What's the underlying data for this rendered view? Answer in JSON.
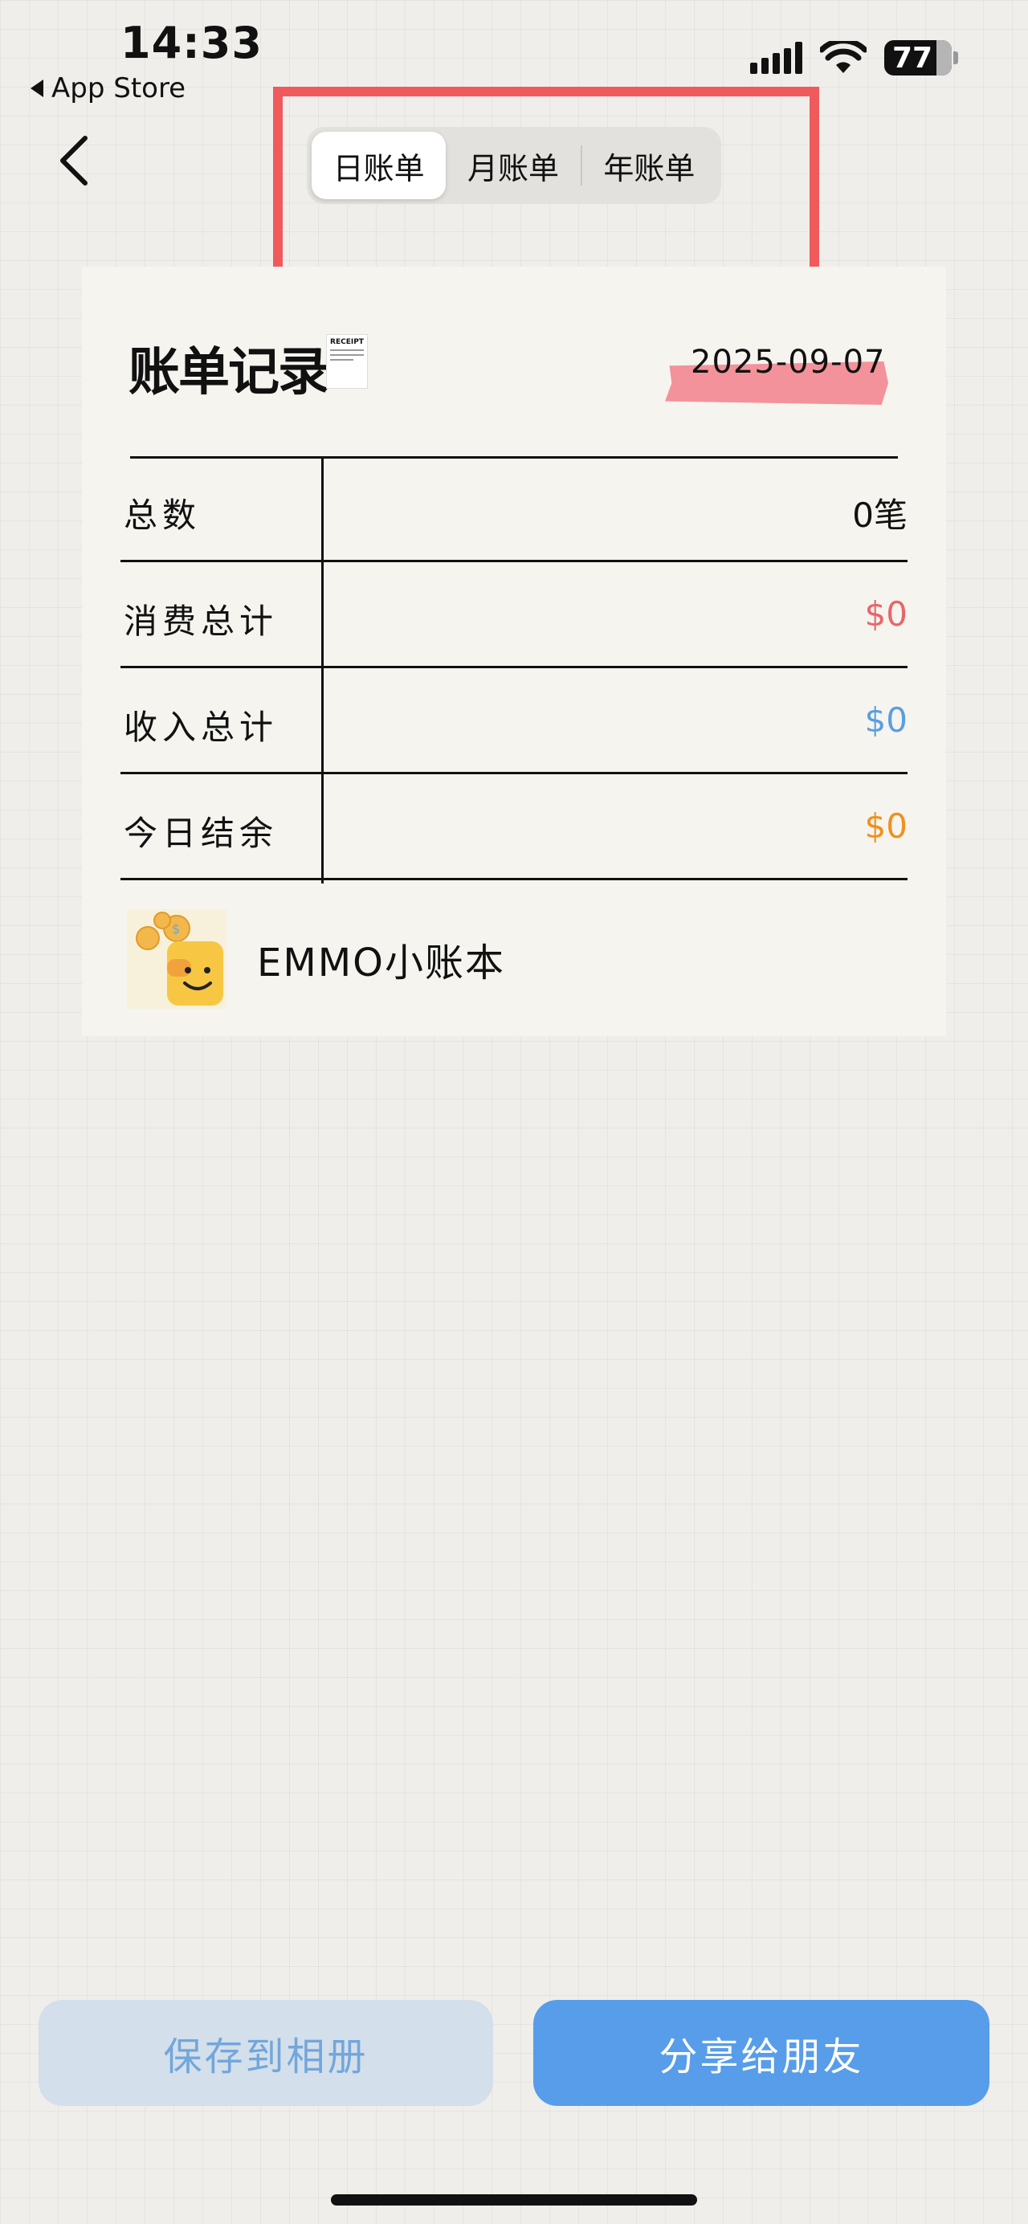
{
  "status_bar": {
    "time": "14:33",
    "back_app": "App Store",
    "battery": "77"
  },
  "tabs": [
    {
      "label": "日账单",
      "active": true
    },
    {
      "label": "月账单",
      "active": false
    },
    {
      "label": "年账单",
      "active": false
    }
  ],
  "card": {
    "title": "账单记录",
    "receipt_icon_text": "RECEIPT",
    "date": "2025-09-07",
    "rows": [
      {
        "label": "总数",
        "value": "0笔",
        "color": "#111111"
      },
      {
        "label": "消费总计",
        "value": "$0",
        "color": "#e8666a"
      },
      {
        "label": "收入总计",
        "value": "$0",
        "color": "#5a9ee0"
      },
      {
        "label": "今日结余",
        "value": "$0",
        "color": "#f0901e"
      }
    ],
    "brand": "EMMO小账本"
  },
  "buttons": {
    "save": "保存到相册",
    "share": "分享给朋友"
  },
  "colors": {
    "accent": "#579de9",
    "highlight": "#f05a5d",
    "date_tag": "#f3929a"
  }
}
